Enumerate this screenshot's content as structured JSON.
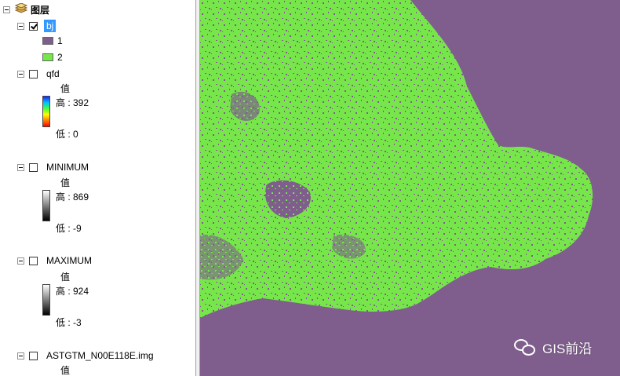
{
  "toc": {
    "root_label": "图层",
    "layers": [
      {
        "name": "bj",
        "checked": true,
        "legend": [
          {
            "label": "1",
            "color": "#7f5e8d"
          },
          {
            "label": "2",
            "color": "#76e64a"
          }
        ]
      },
      {
        "name": "qfd",
        "checked": false,
        "field": "值",
        "high": "高 : 392",
        "low": "低 : 0"
      },
      {
        "name": "MINIMUM",
        "checked": false,
        "field": "值",
        "high": "高 : 869",
        "low": "低 : -9"
      },
      {
        "name": "MAXIMUM",
        "checked": false,
        "field": "值",
        "high": "高 : 924",
        "low": "低 : -3"
      },
      {
        "name": "ASTGTM_N00E118E.img",
        "checked": false,
        "field": "值"
      }
    ]
  },
  "map": {
    "background_color": "#7f5e8d",
    "land_color": "#76e64a"
  },
  "watermark": {
    "text": "GIS前沿",
    "icon": "wechat-icon"
  }
}
